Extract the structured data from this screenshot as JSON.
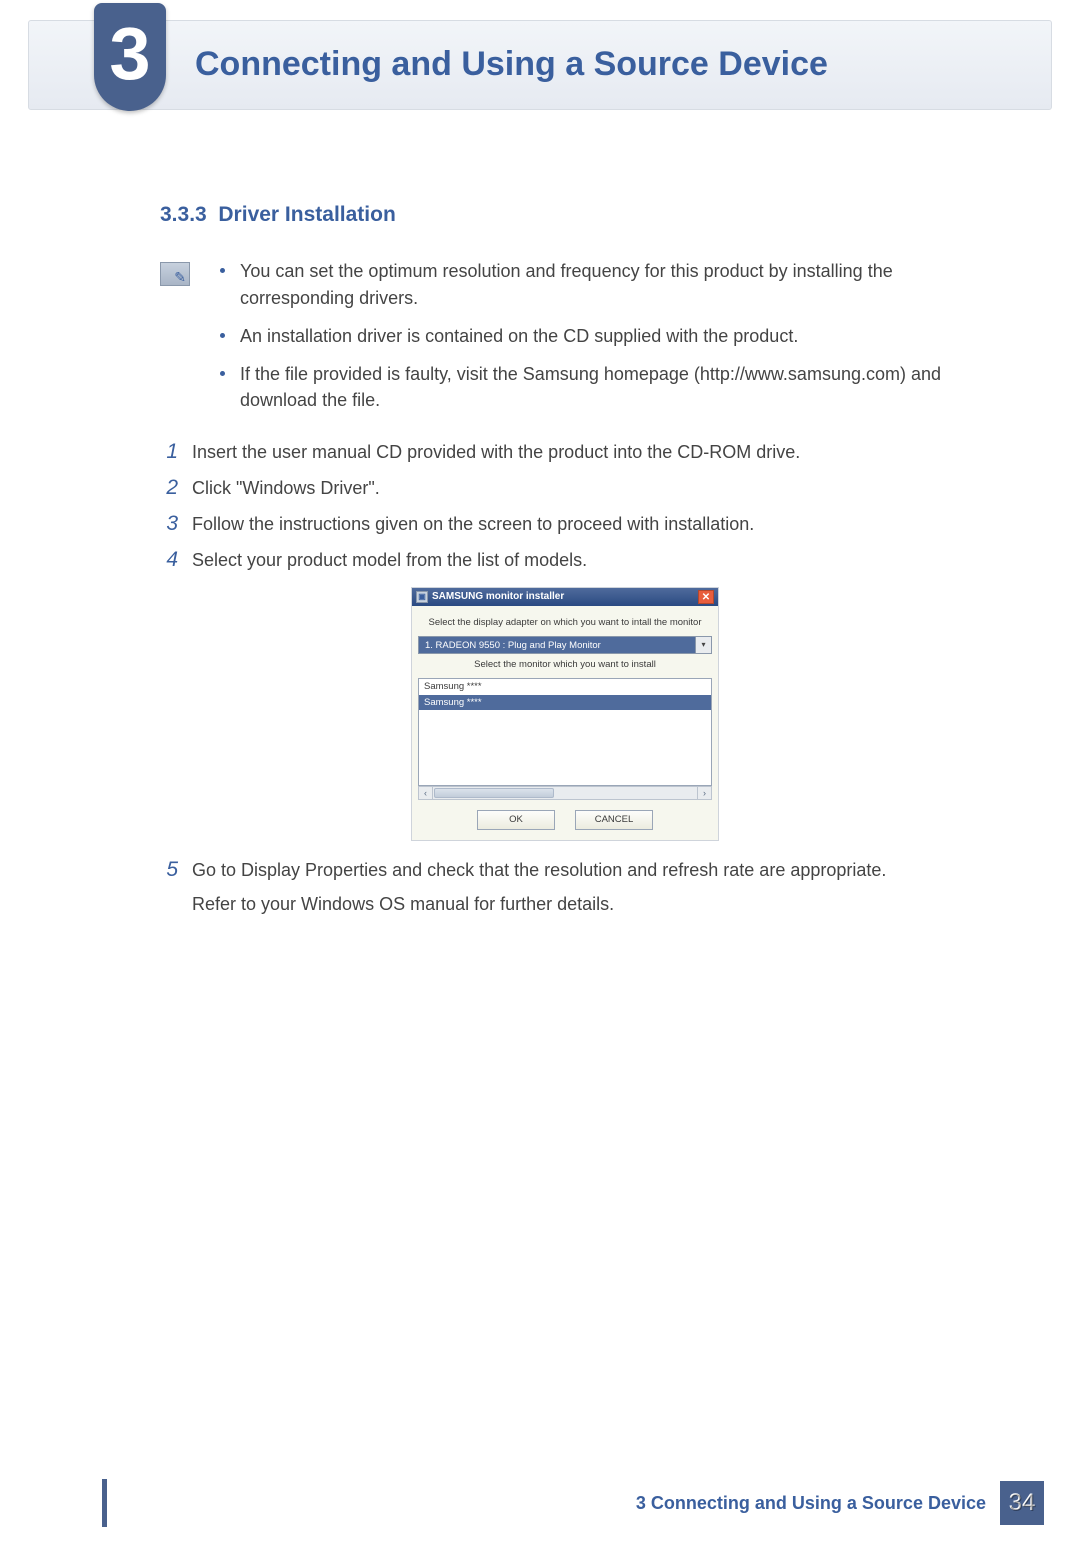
{
  "header": {
    "chapter_number": "3",
    "chapter_title": "Connecting and Using a Source Device"
  },
  "section": {
    "number": "3.3.3",
    "title": "Driver Installation"
  },
  "notes": [
    "You can set the optimum resolution and frequency for this product by installing the corresponding drivers.",
    "An installation driver is contained on the CD supplied with the product.",
    "If the file provided is faulty, visit the Samsung homepage (http://www.samsung.com) and download the file."
  ],
  "steps": {
    "s1": {
      "num": "1",
      "text": "Insert the user manual CD provided with the product into the CD-ROM drive."
    },
    "s2": {
      "num": "2",
      "text": "Click \"Windows Driver\"."
    },
    "s3": {
      "num": "3",
      "text": "Follow the instructions given on the screen to proceed with installation."
    },
    "s4": {
      "num": "4",
      "text": "Select your product model from the list of models."
    },
    "s5": {
      "num": "5",
      "line1": "Go to Display Properties and check that the resolution and refresh rate are appropriate.",
      "line2": "Refer to your Windows OS manual for further details."
    }
  },
  "dialog": {
    "title": "SAMSUNG monitor installer",
    "label1": "Select the display adapter on which you want to intall the monitor",
    "dropdown_value": "1. RADEON 9550 : Plug and Play Monitor",
    "label2": "Select the monitor which you want to install",
    "list_item1": "Samsung ****",
    "list_item2": "Samsung ****",
    "ok": "OK",
    "cancel": "CANCEL"
  },
  "footer": {
    "title": "3 Connecting and Using a Source Device",
    "page": "34"
  }
}
